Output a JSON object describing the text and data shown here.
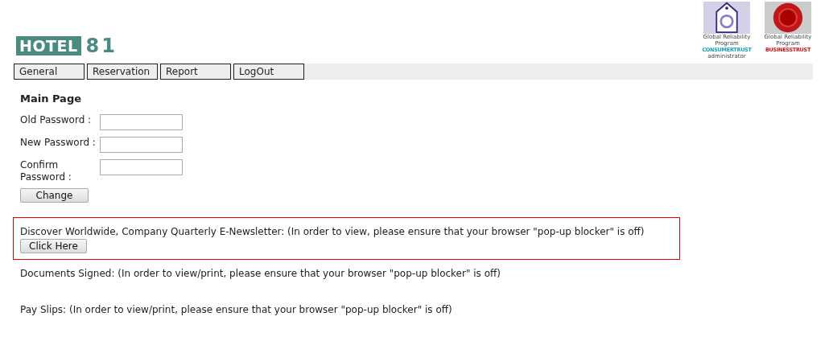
{
  "logo": {
    "word": "HOTEL",
    "number": "81"
  },
  "badges": [
    {
      "kind": "consumer",
      "caption": "Global Reliability Program",
      "brand": "CONSUMERTRUST",
      "sub": "administrator"
    },
    {
      "kind": "business",
      "caption": "Global Reliability Program",
      "brand": "BUSINESSTRUST"
    }
  ],
  "tabs": [
    {
      "label": "General"
    },
    {
      "label": "Reservation"
    },
    {
      "label": "Report"
    },
    {
      "label": "LogOut"
    }
  ],
  "heading": "Main Page",
  "fields": [
    {
      "label": "Old Password :"
    },
    {
      "label": "New Password :"
    },
    {
      "label": "Confirm Password :"
    }
  ],
  "change_button": "Change",
  "newsletter": {
    "text": "Discover Worldwide, Company Quarterly E-Newsletter: (In order to view, please ensure that your browser \"pop-up blocker\" is off)",
    "button": "Click Here"
  },
  "notes": [
    "Documents Signed: (In order to view/print, please ensure that your browser \"pop-up blocker\" is off)",
    "Pay Slips: (In order to view/print, please ensure that your browser \"pop-up blocker\" is off)"
  ]
}
